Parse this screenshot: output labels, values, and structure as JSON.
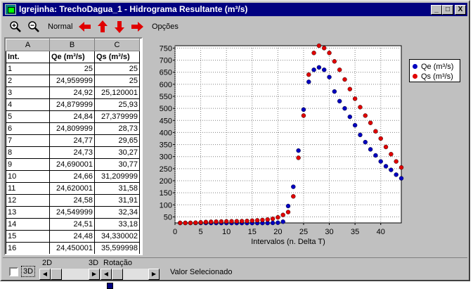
{
  "window": {
    "title": "Igrejinha: TrechoDagua_1 - Hidrograma Resultante (m³/s)",
    "caption_buttons": [
      "_",
      "□",
      "X"
    ]
  },
  "toolbar": {
    "zoom_in_icon": "zoom-in-icon",
    "zoom_out_icon": "zoom-out-icon",
    "normal_label": "Normal",
    "options_label": "Opções",
    "arrow_color": "#e00000"
  },
  "grid": {
    "columns": [
      "A",
      "B",
      "C"
    ],
    "headers": [
      "Int.",
      "Qe (m³/s)",
      "Qs (m³/s)"
    ],
    "rows": [
      [
        "1",
        "25",
        "25"
      ],
      [
        "2",
        "24,959999",
        "25"
      ],
      [
        "3",
        "24,92",
        "25,120001"
      ],
      [
        "4",
        "24,879999",
        "25,93"
      ],
      [
        "5",
        "24,84",
        "27,379999"
      ],
      [
        "6",
        "24,809999",
        "28,73"
      ],
      [
        "7",
        "24,77",
        "29,65"
      ],
      [
        "8",
        "24,73",
        "30,27"
      ],
      [
        "9",
        "24,690001",
        "30,77"
      ],
      [
        "10",
        "24,66",
        "31,209999"
      ],
      [
        "11",
        "24,620001",
        "31,58"
      ],
      [
        "12",
        "24,58",
        "31,91"
      ],
      [
        "13",
        "24,549999",
        "32,34"
      ],
      [
        "14",
        "24,51",
        "33,18"
      ],
      [
        "15",
        "24,48",
        "34,330002"
      ],
      [
        "16",
        "24,450001",
        "35,599998"
      ]
    ]
  },
  "chart_data": {
    "type": "scatter",
    "xlabel": "Intervalos (n. Delta T)",
    "ylabel": "",
    "xlim": [
      0,
      44
    ],
    "ylim": [
      25,
      760
    ],
    "xticks": [
      0,
      5,
      10,
      15,
      20,
      25,
      30,
      35,
      40
    ],
    "yticks": [
      50,
      100,
      150,
      200,
      250,
      300,
      350,
      400,
      450,
      500,
      550,
      600,
      650,
      700,
      750
    ],
    "grid": true,
    "legend_position": "top-right, outside",
    "x": [
      1,
      2,
      3,
      4,
      5,
      6,
      7,
      8,
      9,
      10,
      11,
      12,
      13,
      14,
      15,
      16,
      17,
      18,
      19,
      20,
      21,
      22,
      23,
      24,
      25,
      26,
      27,
      28,
      29,
      30,
      31,
      32,
      33,
      34,
      35,
      36,
      37,
      38,
      39,
      40,
      41,
      42,
      43,
      44
    ],
    "series": [
      {
        "name": "Qe (m³/s)",
        "color": "#0000c0",
        "values": [
          25,
          24.96,
          24.92,
          24.88,
          24.84,
          24.81,
          24.77,
          24.73,
          24.69,
          24.66,
          24.62,
          24.58,
          24.55,
          24.51,
          24.48,
          24.45,
          24.5,
          24.6,
          25,
          26,
          30,
          95,
          175,
          325,
          495,
          610,
          660,
          670,
          660,
          630,
          570,
          530,
          500,
          465,
          430,
          390,
          360,
          330,
          305,
          280,
          260,
          245,
          225,
          210
        ]
      },
      {
        "name": "Qs (m³/s)",
        "color": "#e00000",
        "values": [
          25,
          25,
          25.12,
          25.93,
          27.38,
          28.73,
          29.65,
          30.27,
          30.77,
          31.21,
          31.58,
          31.91,
          32.34,
          33.18,
          34.33,
          35.6,
          37,
          39,
          42,
          48,
          58,
          70,
          135,
          295,
          470,
          640,
          730,
          760,
          750,
          730,
          695,
          660,
          620,
          580,
          540,
          505,
          470,
          440,
          405,
          375,
          340,
          310,
          280,
          255
        ]
      }
    ]
  },
  "bottom": {
    "checkbox_label": "3D",
    "label_2d": "2D",
    "label_3d": "3D",
    "label_rotation": "Rotação",
    "selected_value_label": "Valor Selecionado"
  }
}
